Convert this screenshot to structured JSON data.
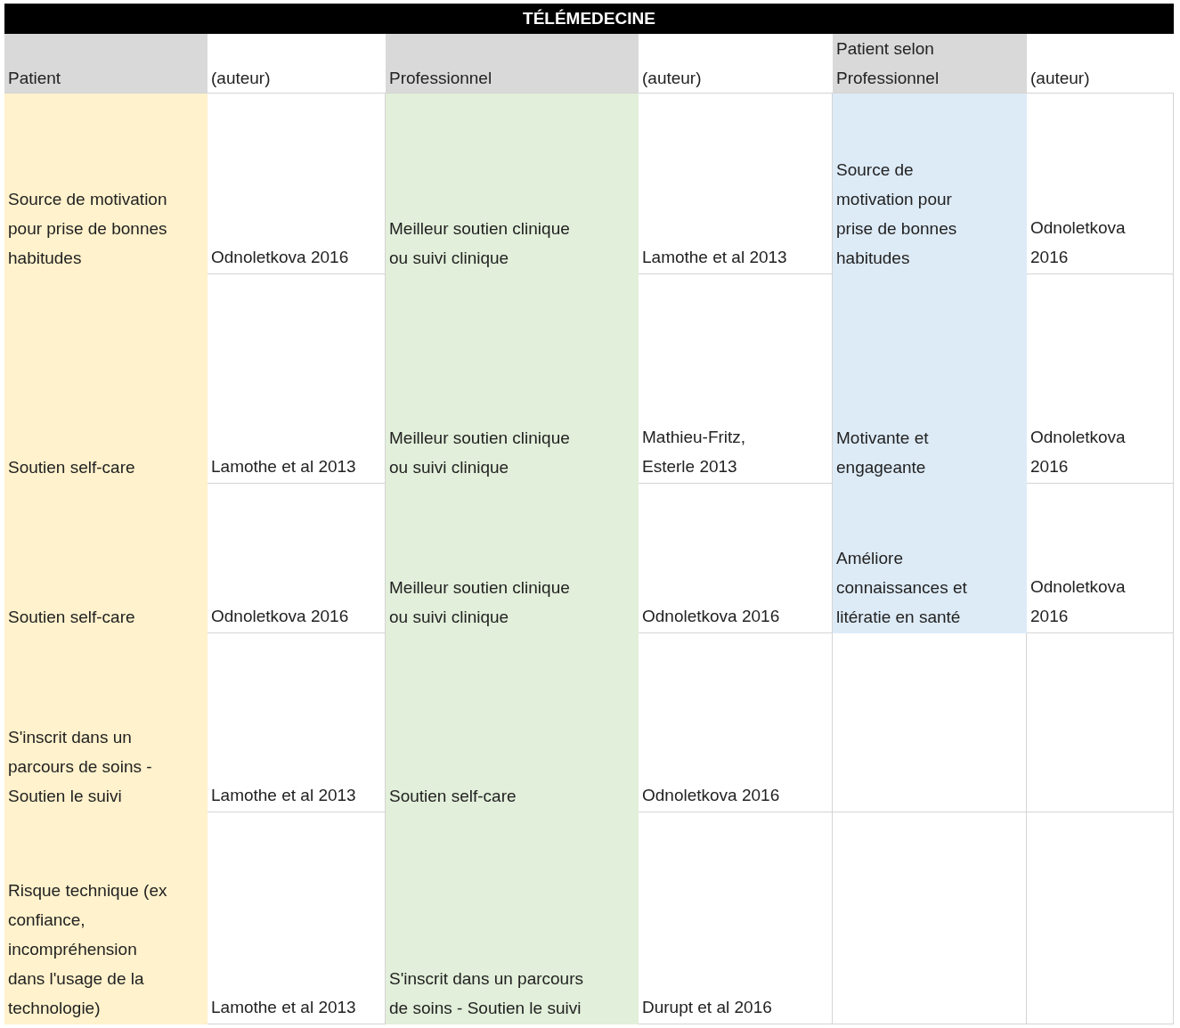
{
  "title": "TÉLÉMEDECINE",
  "columns": [
    {
      "header": "Patient",
      "kind": "group",
      "color": "#fff2cc"
    },
    {
      "header": "(auteur)",
      "kind": "author"
    },
    {
      "header": "Professionnel",
      "kind": "group",
      "color": "#e2efda"
    },
    {
      "header": "(auteur)",
      "kind": "author"
    },
    {
      "header": "Patient selon\nProfessionnel",
      "kind": "group",
      "color": "#ddebf7"
    },
    {
      "header": "(auteur)",
      "kind": "author"
    }
  ],
  "rows": [
    {
      "cells": [
        "Source de motivation\npour prise de bonnes\nhabitudes",
        "Odnoletkova 2016",
        "Meilleur soutien clinique\nou suivi clinique",
        "Lamothe et al 2013",
        "Source de\nmotivation pour\nprise de bonnes\nhabitudes",
        "Odnoletkova\n2016"
      ]
    },
    {
      "cells": [
        "Soutien self-care",
        "Lamothe et al 2013",
        "Meilleur soutien clinique\nou suivi clinique",
        "Mathieu-Fritz,\nEsterle 2013",
        "Motivante et\nengageante",
        "Odnoletkova\n2016"
      ]
    },
    {
      "cells": [
        "Soutien self-care",
        "Odnoletkova 2016",
        "Meilleur soutien clinique\nou suivi clinique",
        "Odnoletkova 2016",
        "Améliore\nconnaissances et\nlitératie en santé",
        "Odnoletkova\n2016"
      ]
    },
    {
      "cells": [
        "S'inscrit dans un\nparcours de soins -\nSoutien le suivi",
        "Lamothe et al 2013",
        "Soutien self-care",
        "Odnoletkova 2016",
        null,
        null
      ]
    },
    {
      "cells": [
        "Risque technique (ex\nconfiance,\nincompréhension\ndans l'usage de la\ntechnologie)",
        "Lamothe et al 2013",
        "S'inscrit dans un parcours\nde soins - Soutien le suivi",
        "Durupt et al 2016",
        null,
        null
      ]
    }
  ]
}
